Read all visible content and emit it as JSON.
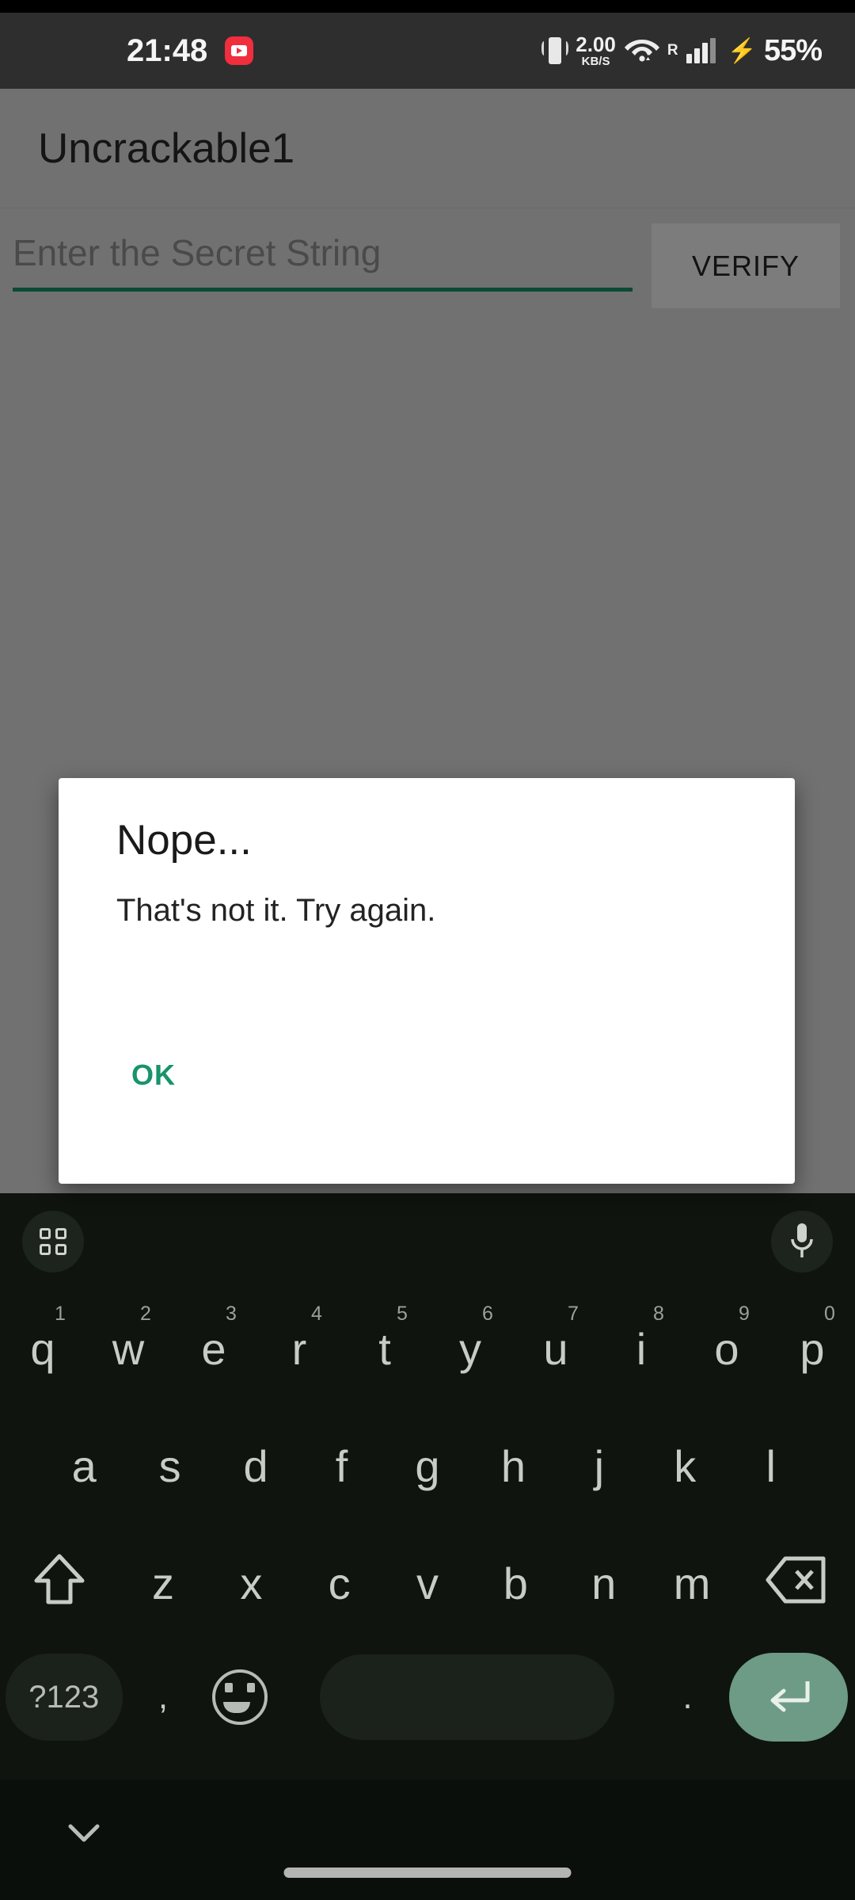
{
  "status_bar": {
    "clock": "21:48",
    "notification_icon": "youtube-icon",
    "vibrate_icon": "vibrate-icon",
    "network_speed_value": "2.00",
    "network_speed_unit": "KB/S",
    "wifi_icon": "wifi-icon",
    "roaming_label": "R",
    "signal_icon": "signal-bars-icon",
    "charging_icon": "charging-bolt-icon",
    "battery_percent": "55%"
  },
  "app": {
    "title": "Uncrackable1",
    "input": {
      "placeholder": "Enter the Secret String",
      "value": "",
      "underline_color": "#0c4a33"
    },
    "verify_label": "VERIFY"
  },
  "dialog": {
    "title": "Nope...",
    "message": "That's not it. Try again.",
    "ok_label": "OK",
    "ok_color": "#17946c"
  },
  "keyboard": {
    "toolbar": {
      "left_icon": "apps-grid-icon",
      "right_icon": "microphone-icon"
    },
    "row1": [
      {
        "key": "q",
        "num": "1"
      },
      {
        "key": "w",
        "num": "2"
      },
      {
        "key": "e",
        "num": "3"
      },
      {
        "key": "r",
        "num": "4"
      },
      {
        "key": "t",
        "num": "5"
      },
      {
        "key": "y",
        "num": "6"
      },
      {
        "key": "u",
        "num": "7"
      },
      {
        "key": "i",
        "num": "8"
      },
      {
        "key": "o",
        "num": "9"
      },
      {
        "key": "p",
        "num": "0"
      }
    ],
    "row2": [
      "a",
      "s",
      "d",
      "f",
      "g",
      "h",
      "j",
      "k",
      "l"
    ],
    "row3": {
      "shift_icon": "shift-icon",
      "letters": [
        "z",
        "x",
        "c",
        "v",
        "b",
        "n",
        "m"
      ],
      "backspace_icon": "backspace-icon"
    },
    "row4": {
      "symbols_label": "?123",
      "comma": ",",
      "emoji_icon": "emoji-icon",
      "space": "",
      "period": ".",
      "enter_icon": "enter-icon",
      "enter_color": "#6d9b85"
    }
  },
  "nav_bar": {
    "hide_keyboard_icon": "chevron-down-icon",
    "home_indicator": "home-indicator"
  }
}
